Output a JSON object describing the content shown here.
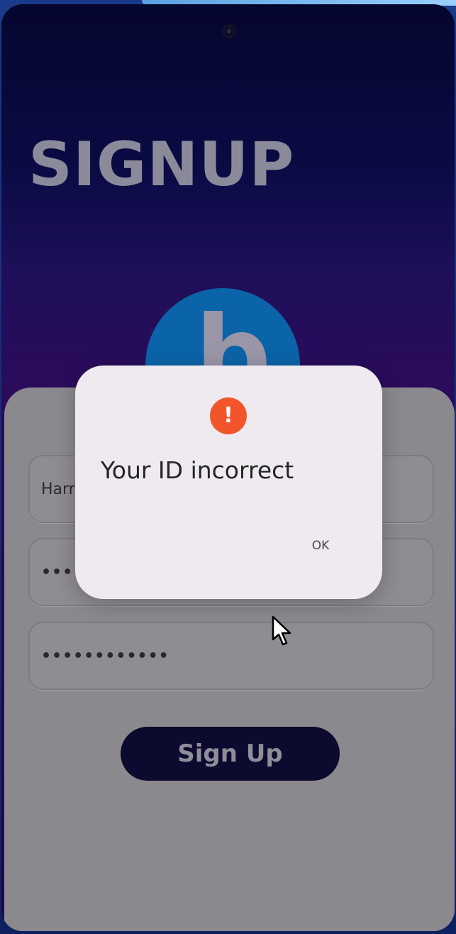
{
  "signup_screen": {
    "title": "SIGNUP",
    "logo_letter": "b",
    "fields": {
      "username_value": "Harr",
      "password_value": "•••••••",
      "confirm_password_value": "••••••••••••"
    },
    "signup_button_label": "Sign Up"
  },
  "dialog": {
    "icon": "warning-icon",
    "icon_glyph": "!",
    "message": "Your ID incorrect",
    "ok_label": "OK"
  },
  "colors": {
    "warning_accent": "#f2552c",
    "button_dark": "#0c0a2e",
    "logo_blue": "#0b64a8"
  }
}
